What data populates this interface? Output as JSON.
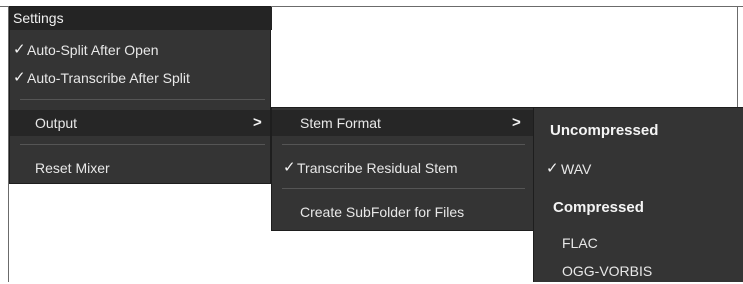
{
  "main_menu": {
    "title": "Settings",
    "items": [
      {
        "label": "Auto-Split After Open",
        "checked": true,
        "check": "✓"
      },
      {
        "label": "Auto-Transcribe After Split",
        "checked": true,
        "check": "✓"
      },
      {
        "label": "Output",
        "submenu_arrow": ">"
      },
      {
        "label": "Reset Mixer"
      }
    ]
  },
  "output_menu": {
    "items": [
      {
        "label": "Stem Format",
        "submenu_arrow": ">"
      },
      {
        "label": "Transcribe Residual Stem",
        "checked": true,
        "check": "✓"
      },
      {
        "label": "Create SubFolder for Files"
      }
    ]
  },
  "stem_format_menu": {
    "uncompressed_heading": "Uncompressed",
    "uncompressed_items": [
      {
        "label": "WAV",
        "checked": true,
        "check": "✓"
      }
    ],
    "compressed_heading": "Compressed",
    "compressed_items": [
      {
        "label": "FLAC"
      },
      {
        "label": "OGG-VORBIS"
      }
    ]
  },
  "colors": {
    "menu_bg": "#343434",
    "header_bg": "#242424",
    "highlight_bg": "#262626",
    "text": "#e8e8e8"
  }
}
